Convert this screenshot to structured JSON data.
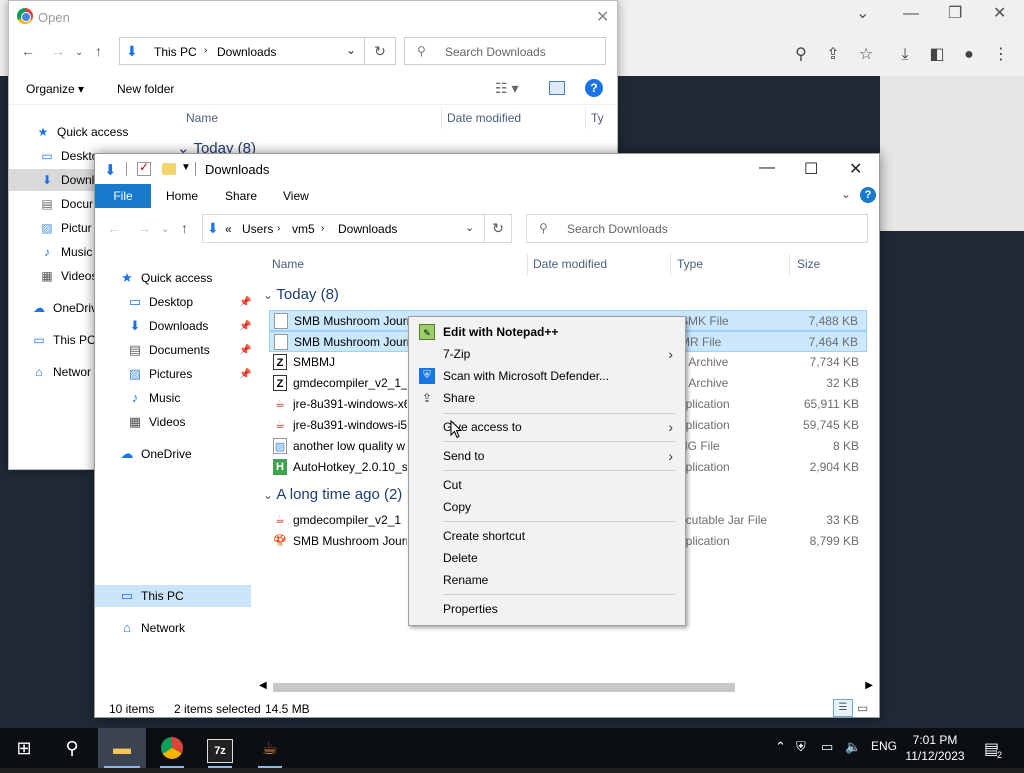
{
  "chrome": {
    "icons": [
      "search-icon",
      "share-icon",
      "star-icon",
      "download-icon",
      "sidebar-icon",
      "profile-icon",
      "menu-icon"
    ]
  },
  "open_dialog": {
    "title": "Open",
    "breadcrumb": [
      "This PC",
      "Downloads"
    ],
    "search_placeholder": "Search Downloads",
    "organize": "Organize ▾",
    "new_folder": "New folder",
    "columns": [
      "Name",
      "Date modified",
      "Ty"
    ],
    "group": "Today (8)",
    "sidebar": [
      "Quick access",
      "Deskto",
      "Downlo",
      "Docur",
      "Pictur",
      "Music",
      "Videos",
      "OneDriv",
      "This PC",
      "Networ"
    ]
  },
  "explorer": {
    "title": "Downloads",
    "ribbon_tabs": [
      "File",
      "Home",
      "Share",
      "View"
    ],
    "breadcrumb_prefix": "«",
    "breadcrumb": [
      "Users",
      "vm5",
      "Downloads"
    ],
    "search_placeholder": "Search Downloads",
    "columns": [
      "Name",
      "Date modified",
      "Type",
      "Size"
    ],
    "sidebar": {
      "quick_access": "Quick access",
      "items": [
        "Desktop",
        "Downloads",
        "Documents",
        "Pictures",
        "Music",
        "Videos"
      ],
      "onedrive": "OneDrive",
      "this_pc": "This PC",
      "network": "Network"
    },
    "groups": {
      "today": "Today (8)",
      "long_ago": "A long time ago (2)"
    },
    "files_today": [
      {
        "name": "SMB Mushroom Journ",
        "type": "SMK File",
        "size": "7,488 KB",
        "selected": true
      },
      {
        "name": "SMB Mushroom Journ",
        "type": "MR File",
        "size": "7,464 KB",
        "selected": true
      },
      {
        "name": "SMBMJ",
        "type": "p Archive",
        "size": "7,734 KB",
        "selected": false
      },
      {
        "name": "gmdecompiler_v2_1_",
        "type": "p Archive",
        "size": "32 KB",
        "selected": false
      },
      {
        "name": "jre-8u391-windows-x6",
        "type": "pplication",
        "size": "65,911 KB",
        "selected": false
      },
      {
        "name": "jre-8u391-windows-i5",
        "type": "pplication",
        "size": "59,745 KB",
        "selected": false
      },
      {
        "name": "another low quality w",
        "type": "NG File",
        "size": "8 KB",
        "selected": false
      },
      {
        "name": "AutoHotkey_2.0.10_se",
        "type": "pplication",
        "size": "2,904 KB",
        "selected": false
      }
    ],
    "files_old": [
      {
        "name": "gmdecompiler_v2_1",
        "type": "ecutable Jar File",
        "size": "33 KB"
      },
      {
        "name": "SMB Mushroom Journ",
        "type": "pplication",
        "size": "8,799 KB"
      }
    ],
    "status": {
      "items": "10 items",
      "selected": "2 items selected",
      "size": "14.5 MB"
    }
  },
  "context_menu": {
    "items": [
      {
        "label": "Edit with Notepad++",
        "icon": "notepad-plus-icon",
        "bold": true
      },
      {
        "label": "7-Zip",
        "submenu": true
      },
      {
        "label": "Scan with Microsoft Defender...",
        "icon": "defender-icon"
      },
      {
        "label": "Share",
        "icon": "share-icon"
      },
      {
        "label": "Give access to",
        "submenu": true
      },
      {
        "label": "Send to",
        "submenu": true
      },
      {
        "label": "Cut"
      },
      {
        "label": "Copy"
      },
      {
        "label": "Create shortcut"
      },
      {
        "label": "Delete"
      },
      {
        "label": "Rename"
      },
      {
        "label": "Properties"
      }
    ]
  },
  "taskbar": {
    "apps": [
      "start-icon",
      "search-icon",
      "file-explorer-icon",
      "chrome-icon",
      "7zip-icon",
      "java-icon"
    ],
    "seven_zip_label": "7z",
    "language": "ENG",
    "time": "7:01 PM",
    "date": "11/12/2023",
    "notification_count": "2"
  }
}
